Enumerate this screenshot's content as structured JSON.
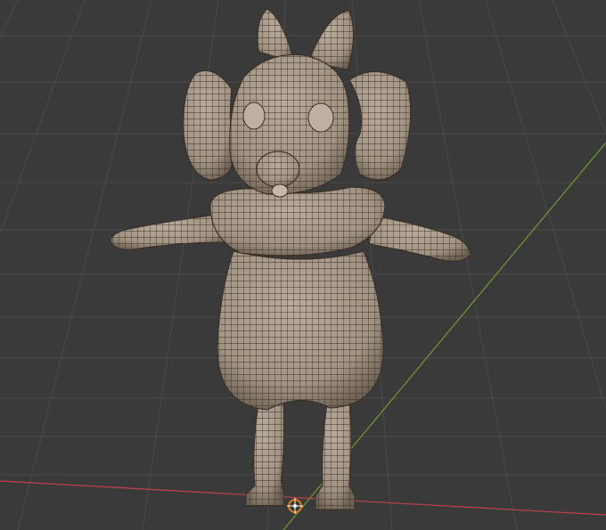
{
  "viewport": {
    "background": "#3a3a3a",
    "grid_color": "#4a4a4a",
    "x_axis_color": "#c0414e",
    "y_axis_color": "#6f9a36",
    "mesh_fill": "#a8998a",
    "mesh_shade": "#7c6f62",
    "wire_color": "#3a3028",
    "origin_marker_color": "#e07a1f"
  },
  "model": {
    "icon": "wireframe-mesh-icon"
  },
  "origin": {
    "icon": "3d-cursor-icon"
  }
}
